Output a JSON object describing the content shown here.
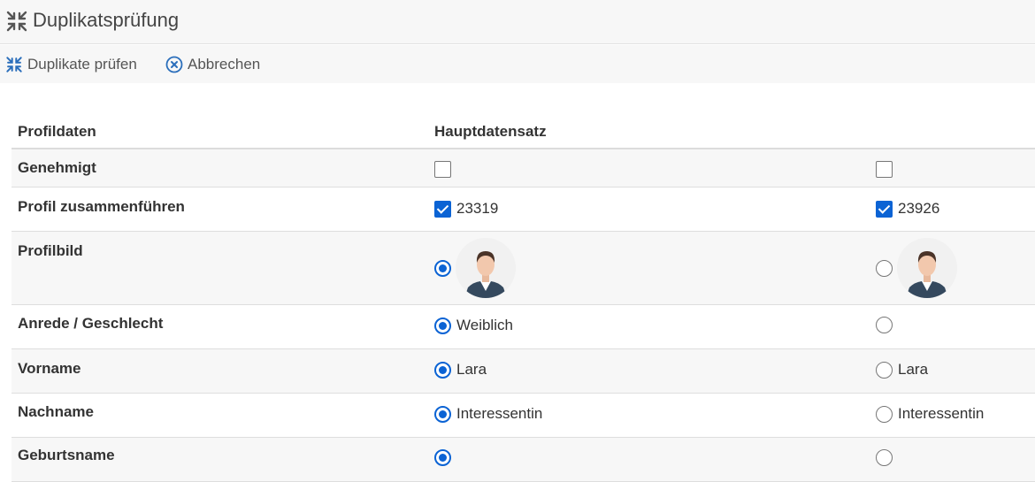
{
  "header": {
    "title": "Duplikatsprüfung",
    "icon": "merge-icon"
  },
  "toolbar": {
    "check_label": "Duplikate prüfen",
    "cancel_label": "Abbrechen"
  },
  "table": {
    "col_profile": "Profildaten",
    "col_main": "Hauptdatensatz",
    "rows": {
      "approved": {
        "label": "Genehmigt",
        "a_checked": false,
        "b_checked": false
      },
      "merge": {
        "label": "Profil zusammenführen",
        "a_value": "23319",
        "b_value": "23926",
        "a_checked": true,
        "b_checked": true
      },
      "picture": {
        "label": "Profilbild",
        "a_selected": true,
        "b_selected": false
      },
      "salutation": {
        "label": "Anrede / Geschlecht",
        "a_value": "Weiblich",
        "b_value": "",
        "a_selected": true,
        "b_selected": false
      },
      "firstname": {
        "label": "Vorname",
        "a_value": "Lara",
        "b_value": "Lara",
        "a_selected": true,
        "b_selected": false
      },
      "lastname": {
        "label": "Nachname",
        "a_value": "Interessentin",
        "b_value": "Interessentin",
        "a_selected": true,
        "b_selected": false
      },
      "birthname": {
        "label": "Geburtsname"
      }
    }
  },
  "colors": {
    "accent": "#0b63d4",
    "icon_blue": "#2a6ebb",
    "row_alt": "#f7f7f7"
  }
}
